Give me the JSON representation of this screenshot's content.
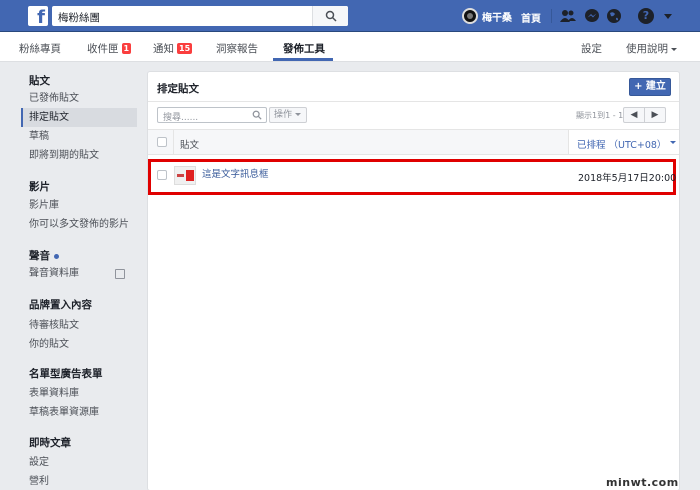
{
  "topbar": {
    "search_value": "梅粉絲團",
    "user_name": "梅干桑",
    "home_label": "首頁",
    "icons": [
      "friends-icon",
      "messenger-icon",
      "globe-icon",
      "help-icon"
    ],
    "help_glyph": "?"
  },
  "subnav": {
    "items": [
      {
        "label": "粉絲專頁"
      },
      {
        "label": "收件匣",
        "badge": "1"
      },
      {
        "label": "通知",
        "badge": "15"
      },
      {
        "label": "洞察報告"
      },
      {
        "label": "發佈工具"
      }
    ],
    "active": "發佈工具",
    "settings_label": "設定",
    "help_label": "使用說明"
  },
  "sidebar": {
    "sections": [
      {
        "heading": "貼文",
        "items": [
          "已發佈貼文",
          "排定貼文",
          "草稿",
          "即將到期的貼文"
        ]
      },
      {
        "heading": "影片",
        "items": [
          "影片庫",
          "你可以多文發佈的影片"
        ]
      },
      {
        "heading": "聲音",
        "items": [
          "聲音資料庫"
        ]
      },
      {
        "heading": "品牌置入內容",
        "items": [
          "待審核貼文",
          "你的貼文"
        ]
      },
      {
        "heading": "名單型廣告表單",
        "items": [
          "表單資料庫",
          "草稿表單資源庫"
        ]
      },
      {
        "heading": "即時文章",
        "items": [
          "設定",
          "營利"
        ]
      }
    ],
    "active_item": "排定貼文"
  },
  "panel": {
    "title": "排定貼文",
    "create_label": "+ 建立",
    "search_placeholder": "搜尋......",
    "action_label": "操作",
    "pager_text": "顯示1到1 - 1",
    "pager_prev": "◀",
    "pager_next": "▶",
    "col_post": "貼文",
    "col_schedule": "已排程 （UTC+08）",
    "rows": [
      {
        "title": "這是文字訊息框",
        "date": "2018年5月17日20:00"
      }
    ]
  },
  "watermark": "minwt.com",
  "colors": {
    "brand": "#4267b2",
    "badge": "#fa3e3e",
    "highlight": "#e00000"
  }
}
